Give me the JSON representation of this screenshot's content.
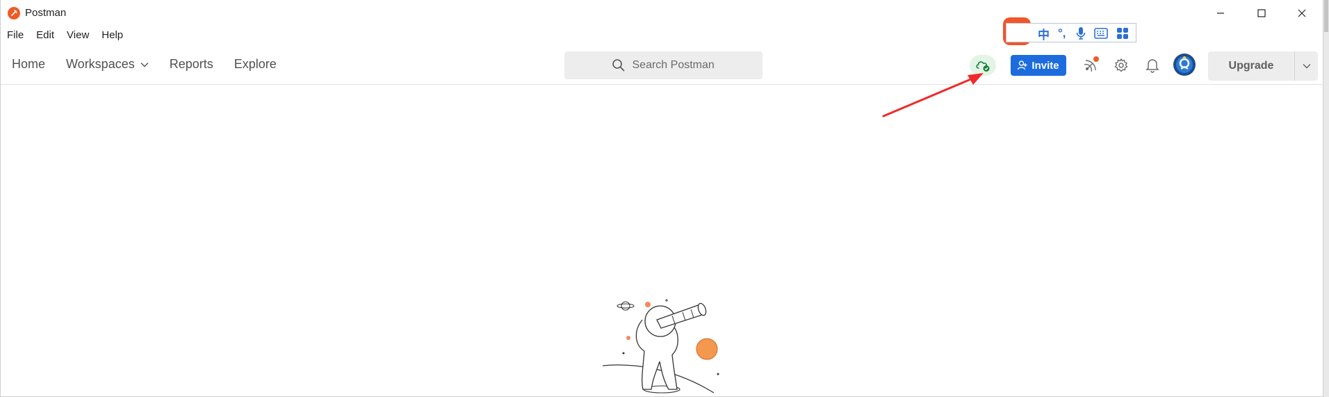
{
  "window": {
    "title": "Postman"
  },
  "menu": {
    "items": [
      "File",
      "Edit",
      "View",
      "Help"
    ]
  },
  "nav": {
    "items": [
      {
        "label": "Home",
        "has_dropdown": false
      },
      {
        "label": "Workspaces",
        "has_dropdown": true
      },
      {
        "label": "Reports",
        "has_dropdown": false
      },
      {
        "label": "Explore",
        "has_dropdown": false
      }
    ]
  },
  "search": {
    "placeholder": "Search Postman"
  },
  "header": {
    "invite_label": "Invite",
    "upgrade_label": "Upgrade",
    "sync_status": "synced",
    "icons": [
      "cloud-sync-icon",
      "radar-icon",
      "gear-icon",
      "bell-icon",
      "avatar"
    ]
  },
  "ime": {
    "mode_label": "中",
    "punct_label": "°,",
    "icons": [
      "sogou-logo",
      "microphone-icon",
      "keyboard-icon",
      "toolbox-icon"
    ]
  },
  "colors": {
    "brand": "#ef5b25",
    "invite_button": "#1c6cde",
    "sync_bg": "#e3f4e6",
    "sync_icon": "#13803a",
    "annotation_arrow": "#f02a2a"
  }
}
